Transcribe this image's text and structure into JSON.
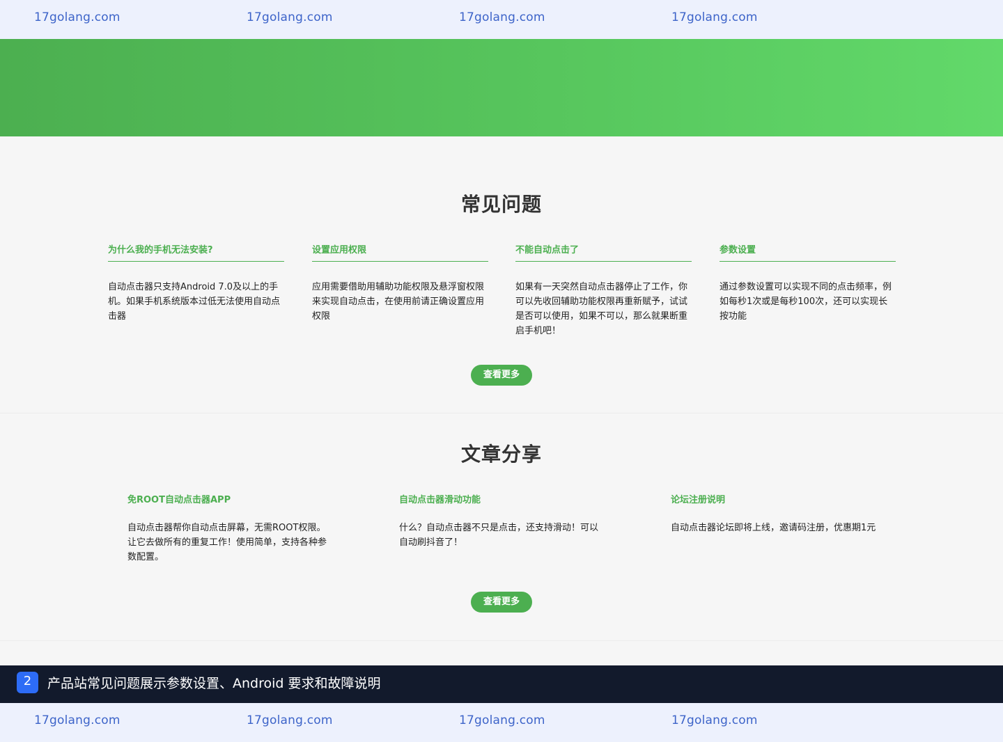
{
  "watermark": {
    "top": [
      "17golang.com",
      "17golang.com",
      "17golang.com",
      "17golang.com"
    ],
    "bottom": [
      "17golang.com",
      "17golang.com",
      "17golang.com",
      "17golang.com"
    ]
  },
  "colors": {
    "accent": "#4caf50",
    "caption_bg": "#121a2c",
    "badge": "#2d6cf6",
    "watermark": "#3d64c9"
  },
  "faq": {
    "title": "常见问题",
    "cards": [
      {
        "title": "为什么我的手机无法安装?",
        "body": "自动点击器只支持Android 7.0及以上的手机。如果手机系统版本过低无法使用自动点击器"
      },
      {
        "title": "设置应用权限",
        "body": "应用需要借助用辅助功能权限及悬浮窗权限来实现自动点击，在使用前请正确设置应用权限"
      },
      {
        "title": "不能自动点击了",
        "body": "如果有一天突然自动点击器停止了工作，你可以先收回辅助功能权限再重新赋予，试试是否可以使用，如果不可以，那么就果断重启手机吧！"
      },
      {
        "title": "参数设置",
        "body": "通过参数设置可以实现不同的点击频率，例如每秒1次或是每秒100次，还可以实现长按功能"
      }
    ],
    "more_label": "查看更多"
  },
  "articles": {
    "title": "文章分享",
    "cards": [
      {
        "title": "免ROOT自动点击器APP",
        "body": "自动点击器帮你自动点击屏幕，无需ROOT权限。让它去做所有的重复工作！使用简单，支持各种参数配置。"
      },
      {
        "title": "自动点击器滑动功能",
        "body": "什么？自动点击器不只是点击，还支持滑动！可以自动刷抖音了！"
      },
      {
        "title": "论坛注册说明",
        "body": "自动点击器论坛即将上线，邀请码注册，优惠期1元"
      }
    ],
    "more_label": "查看更多"
  },
  "caption": {
    "badge": "2",
    "text": "产品站常见问题展示参数设置、Android 要求和故障说明"
  }
}
